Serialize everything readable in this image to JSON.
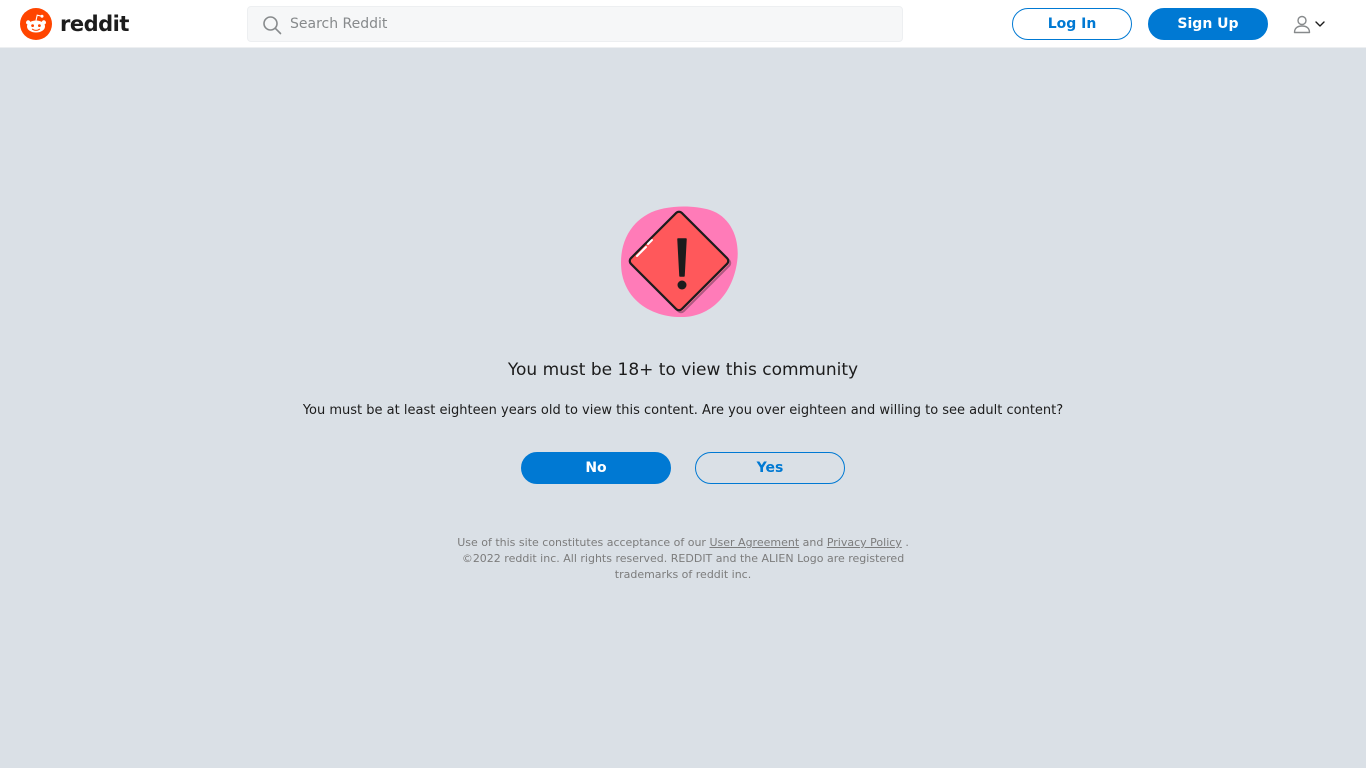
{
  "header": {
    "logo_text": "reddit",
    "search": {
      "placeholder": "Search Reddit",
      "value": ""
    },
    "login_label": "Log In",
    "signup_label": "Sign Up",
    "user_menu_icon": "user-icon",
    "brand_color": "#ff4500",
    "accent_color": "#0079d3"
  },
  "gate": {
    "icon": "warning-icon",
    "title": "You must be 18+ to view this community",
    "description": "You must be at least eighteen years old to view this content. Are you over eighteen and willing to see adult content?",
    "no_label": "No",
    "yes_label": "Yes"
  },
  "legal": {
    "prefix": "Use of this site constitutes acceptance of our",
    "user_agreement": "User Agreement",
    "and": "and",
    "privacy_policy": "Privacy Policy",
    "period": ".",
    "copyright": "©2022 reddit inc. All rights reserved. REDDIT and the ALIEN Logo are registered trademarks of reddit inc."
  }
}
